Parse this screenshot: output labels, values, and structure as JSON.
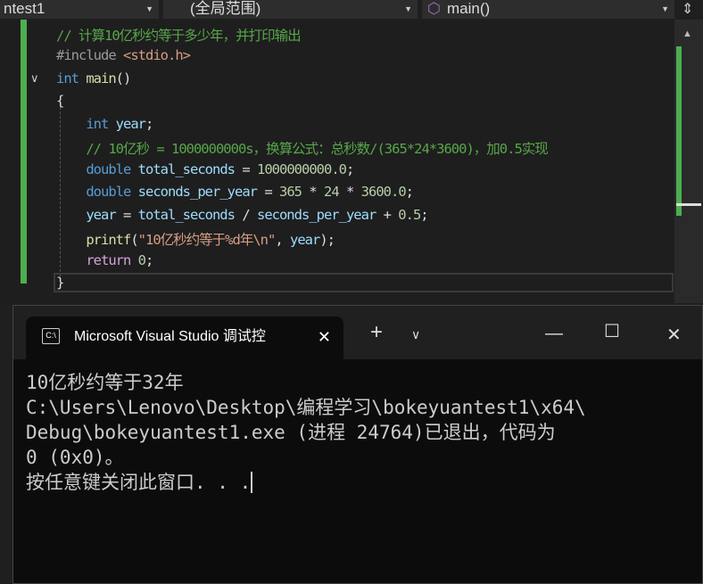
{
  "nav": {
    "project": "ntest1",
    "scope": "(全局范围)",
    "member": "main()"
  },
  "code": [
    "// 计算10亿秒约等于多少年，并打印输出",
    "#include <stdio.h>",
    "int main()",
    "{",
    "    int year;",
    "    // 10亿秒 = 1000000000s，换算公式：总秒数/(365*24*3600)，加0.5实现",
    "    double total_seconds = 1000000000.0;",
    "    double seconds_per_year = 365 * 24 * 3600.0;",
    "    year = total_seconds / seconds_per_year + 0.5;",
    "    printf(\"10亿秒约等于%d年\\n\", year);",
    "    return 0;",
    "}"
  ],
  "terminal": {
    "tab_title": "Microsoft Visual Studio 调试控",
    "lines": [
      "10亿秒约等于32年",
      "",
      "C:\\Users\\Lenovo\\Desktop\\编程学习\\bokeyuantest1\\x64\\",
      "Debug\\bokeyuantest1.exe (进程 24764)已退出，代码为",
      "0 (0x0)。",
      "按任意键关闭此窗口. . ."
    ]
  }
}
